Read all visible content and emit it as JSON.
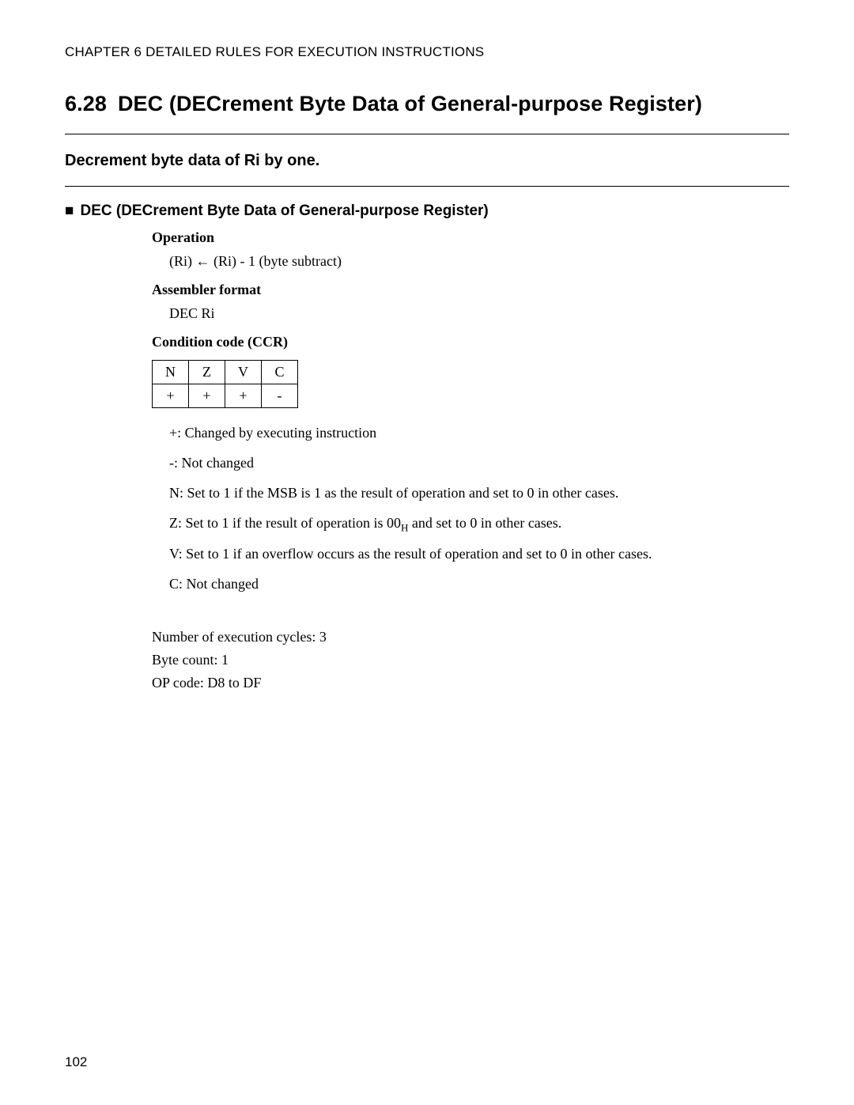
{
  "chapter_header": "CHAPTER 6  DETAILED RULES FOR EXECUTION INSTRUCTIONS",
  "section": {
    "number": "6.28",
    "title": "DEC (DECrement Byte Data of General-purpose Register)"
  },
  "summary": "Decrement byte data of Ri by one.",
  "subheading": "DEC (DECrement Byte Data of General-purpose Register)",
  "operation": {
    "label": "Operation",
    "text": "(Ri) ← (Ri) - 1 (byte subtract)"
  },
  "assembler": {
    "label": "Assembler format",
    "text": "DEC Ri"
  },
  "ccr": {
    "label": "Condition code (CCR)",
    "headers": [
      "N",
      "Z",
      "V",
      "C"
    ],
    "values": [
      "+",
      "+",
      "+",
      "-"
    ]
  },
  "ccr_notes": {
    "plus": "+: Changed by executing instruction",
    "minus": "-: Not changed",
    "N": "N: Set to 1 if the MSB is 1 as the result of operation and set to 0 in other cases.",
    "Z_pre": "Z: Set to 1 if the result of operation is 00",
    "Z_sub": "H",
    "Z_post": " and set to 0 in other cases.",
    "V": "V: Set to 1 if an overflow occurs as the result of operation and set to 0 in other cases.",
    "C": "C: Not changed"
  },
  "meta": {
    "cycles": "Number of execution cycles: 3",
    "bytes": "Byte count: 1",
    "opcode": "OP code: D8 to DF"
  },
  "page_number": "102"
}
